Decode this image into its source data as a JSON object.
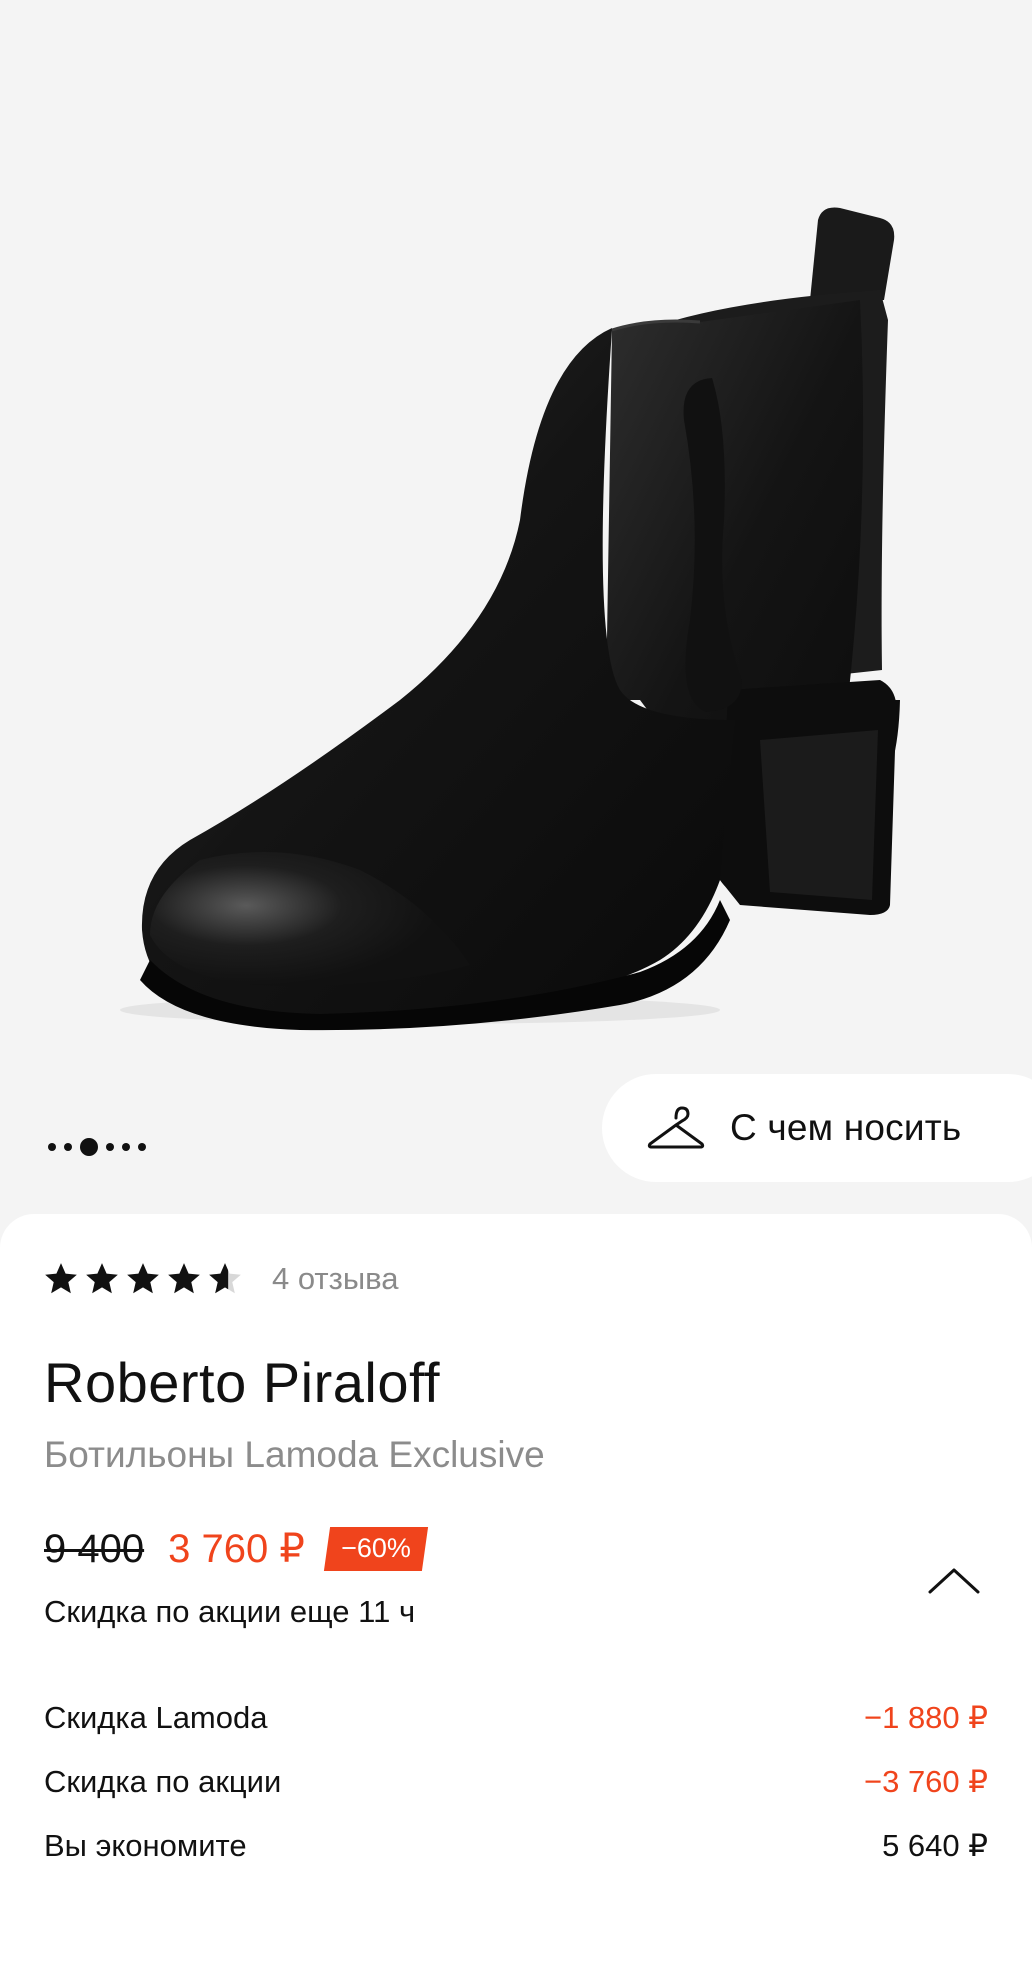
{
  "gallery": {
    "outfit_button_label": "С чем носить",
    "page_count": 6,
    "active_page": 3
  },
  "rating": {
    "stars": 4.5,
    "reviews_label": "4 отзыва"
  },
  "product": {
    "brand": "Roberto Piraloff",
    "subtitle": "Ботильоны Lamoda Exclusive"
  },
  "price": {
    "old": "9 400",
    "current": "3 760 ₽",
    "discount_badge": "−60%",
    "promo_note": "Скидка по акции еще 11 ч"
  },
  "breakdown": [
    {
      "label": "Скидка Lamoda",
      "value": "−1 880 ₽",
      "highlight": true
    },
    {
      "label": "Скидка по акции",
      "value": "−3 760 ₽",
      "highlight": true
    },
    {
      "label": "Вы экономите",
      "value": "5 640 ₽",
      "highlight": false
    }
  ],
  "colors": {
    "accent": "#f0441c",
    "muted_text": "#8c8c8c",
    "background": "#f4f4f4"
  }
}
